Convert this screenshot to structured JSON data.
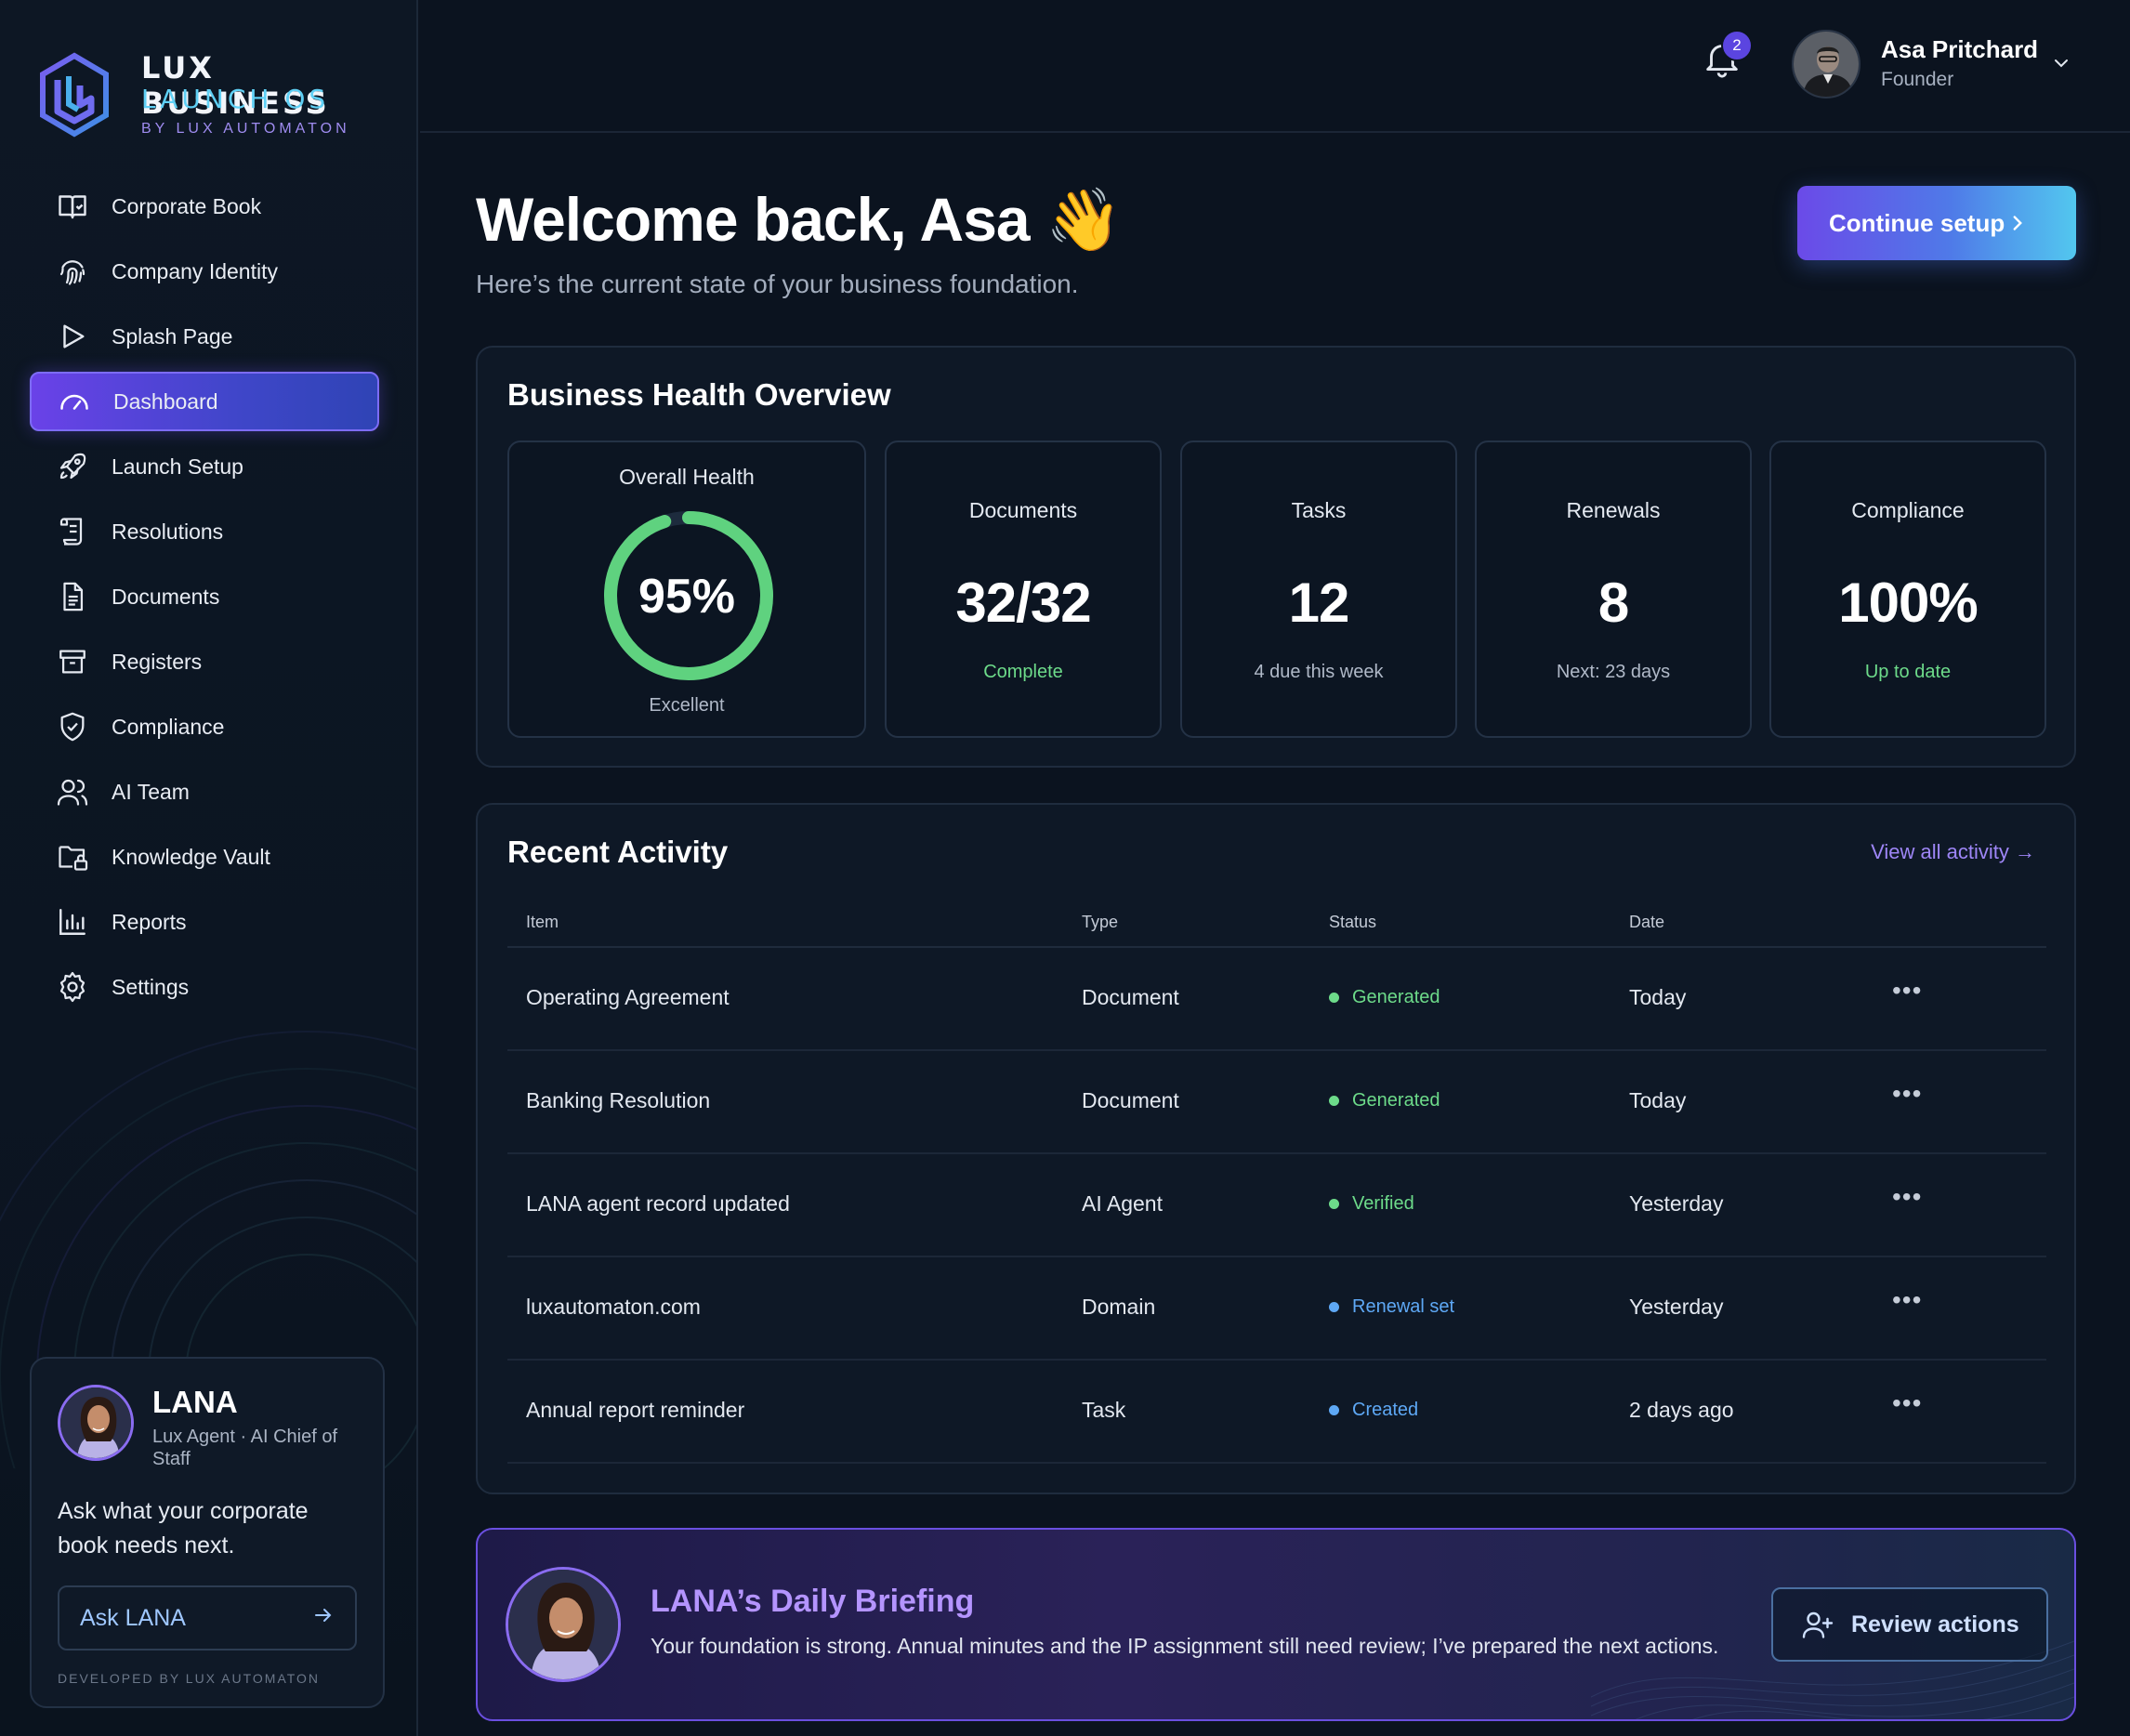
{
  "brand": {
    "line1": "LUX BUSINESS",
    "line2": "LAUNCH OS",
    "line3": "BY LUX AUTOMATON"
  },
  "sidebar": {
    "items": [
      {
        "label": "Corporate Book",
        "icon": "book-icon"
      },
      {
        "label": "Company Identity",
        "icon": "fingerprint-icon"
      },
      {
        "label": "Splash Page",
        "icon": "play-icon"
      },
      {
        "label": "Dashboard",
        "icon": "gauge-icon",
        "active": true
      },
      {
        "label": "Launch Setup",
        "icon": "rocket-icon"
      },
      {
        "label": "Resolutions",
        "icon": "scroll-icon"
      },
      {
        "label": "Documents",
        "icon": "document-icon"
      },
      {
        "label": "Registers",
        "icon": "archive-icon"
      },
      {
        "label": "Compliance",
        "icon": "shield-check-icon"
      },
      {
        "label": "AI Team",
        "icon": "users-icon"
      },
      {
        "label": "Knowledge Vault",
        "icon": "folder-lock-icon"
      },
      {
        "label": "Reports",
        "icon": "bar-chart-icon"
      },
      {
        "label": "Settings",
        "icon": "gear-icon"
      }
    ],
    "lana_card": {
      "name": "LANA",
      "role": "Lux Agent · AI Chief of Staff",
      "prompt": "Ask what your corporate book needs next.",
      "ask_label": "Ask LANA",
      "developed_by": "DEVELOPED BY LUX AUTOMATON"
    }
  },
  "header": {
    "notification_count": "2",
    "user_name": "Asa Pritchard",
    "user_role": "Founder"
  },
  "main": {
    "welcome_title": "Welcome back, Asa 👋",
    "welcome_subtitle": "Here’s the current state of your business foundation.",
    "continue_label": "Continue setup"
  },
  "health": {
    "title": "Business Health Overview",
    "overall": {
      "label": "Overall Health",
      "value": "95%",
      "percent": 95,
      "sub": "Excellent"
    },
    "cards": [
      {
        "label": "Documents",
        "value": "32/32",
        "sub": "Complete",
        "sub_green": true
      },
      {
        "label": "Tasks",
        "value": "12",
        "sub": "4 due this week",
        "sub_green": false
      },
      {
        "label": "Renewals",
        "value": "8",
        "sub": "Next: 23 days",
        "sub_green": false
      },
      {
        "label": "Compliance",
        "value": "100%",
        "sub": "Up to date",
        "sub_green": true
      }
    ]
  },
  "activity": {
    "title": "Recent Activity",
    "view_all": "View all activity →",
    "columns": [
      "Item",
      "Type",
      "Status",
      "Date"
    ],
    "rows": [
      {
        "item": "Operating Agreement",
        "type": "Document",
        "status": "Generated",
        "status_color": "#6ddb8a",
        "date": "Today"
      },
      {
        "item": "Banking Resolution",
        "type": "Document",
        "status": "Generated",
        "status_color": "#6ddb8a",
        "date": "Today"
      },
      {
        "item": "LANA agent record updated",
        "type": "AI Agent",
        "status": "Verified",
        "status_color": "#6ddb8a",
        "date": "Yesterday"
      },
      {
        "item": "luxautomaton.com",
        "type": "Domain",
        "status": "Renewal set",
        "status_color": "#5ea8f5",
        "date": "Yesterday"
      },
      {
        "item": "Annual report reminder",
        "type": "Task",
        "status": "Created",
        "status_color": "#5ea8f5",
        "date": "2 days ago"
      }
    ]
  },
  "briefing": {
    "title": "LANA’s Daily Briefing",
    "text": "Your foundation is strong. Annual minutes and the IP assignment still need review; I’ve prepared the next actions.",
    "button_label": "Review actions"
  },
  "colors": {
    "accent": "#6a42e8",
    "success": "#6ddb8a",
    "info": "#5ea8f5",
    "background": "#0b131f"
  }
}
